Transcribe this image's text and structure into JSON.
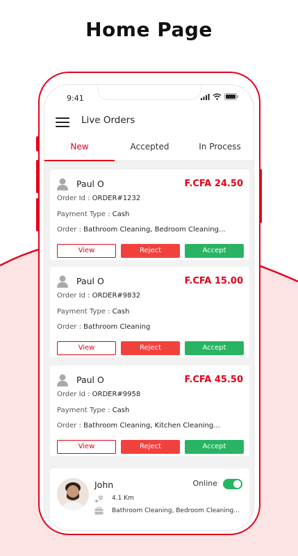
{
  "heading": "Home Page",
  "status": {
    "time": "9:41"
  },
  "header": {
    "title": "Live Orders"
  },
  "tabs": [
    {
      "label": "New",
      "active": true
    },
    {
      "label": "Accepted",
      "active": false
    },
    {
      "label": "In Process",
      "active": false
    }
  ],
  "labels": {
    "order_id": "Order Id :",
    "payment_type": "Payment Type :",
    "order": "Order :",
    "view": "View",
    "reject": "Reject",
    "accept": "Accept"
  },
  "orders": [
    {
      "customer": "Paul O",
      "price": "F.CFA 24.50",
      "order_id": "ORDER#1232",
      "payment": "Cash",
      "services": "Bathroom Cleaning, Bedroom Cleaning..."
    },
    {
      "customer": "Paul O",
      "price": "F.CFA 15.00",
      "order_id": "ORDER#9832",
      "payment": "Cash",
      "services": "Bathroom Cleaning"
    },
    {
      "customer": "Paul O",
      "price": "F.CFA 45.50",
      "order_id": "ORDER#9958",
      "payment": "Cash",
      "services": "Bathroom Cleaning, Kitchen Cleaning..."
    }
  ],
  "driver": {
    "name": "John",
    "status_label": "Online",
    "online": true,
    "distance": "4.1 Km",
    "services": "Bathroom Cleaning, Bedroom Cleaning..."
  },
  "colors": {
    "accent": "#e3001b",
    "reject": "#f2413d",
    "accept": "#28b463",
    "wave": "#fde4e4"
  },
  "icons": [
    "menu-icon",
    "user-icon",
    "signal-icon",
    "wifi-icon",
    "battery-icon",
    "location-icon",
    "briefcase-icon",
    "avatar"
  ]
}
